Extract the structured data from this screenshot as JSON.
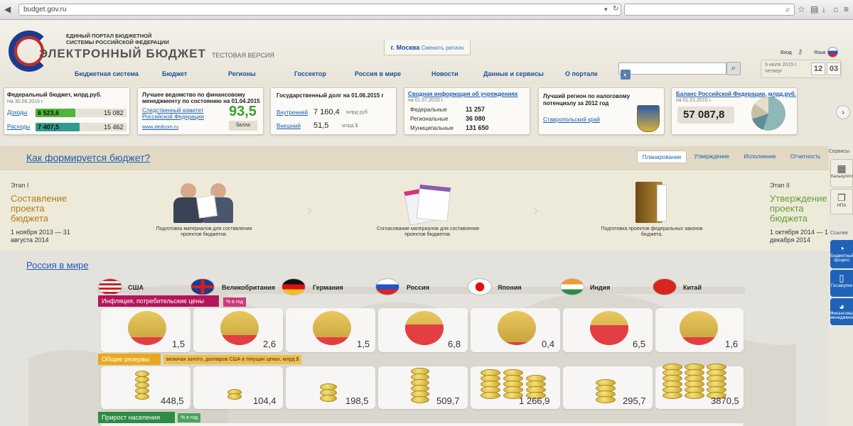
{
  "browser": {
    "url": "budget.gov.ru"
  },
  "header": {
    "logo_small": "ЕДИНЫЙ ПОРТАЛ БЮДЖЕТНОЙ СИСТЕМЫ РОССИЙСКОЙ ФЕДЕРАЦИИ",
    "logo_big": "ЭЛЕКТРОННЫЙ БЮДЖЕТ",
    "test_version": "ТЕСТОВАЯ ВЕРСИЯ",
    "city": "г. Москва",
    "change_region": "Сменить регион",
    "login": "Вход",
    "lang": "Язык",
    "date_line1": "9 июля 2015 г.",
    "date_line2": "четверг",
    "clock_h": "12",
    "clock_m": "03"
  },
  "nav": [
    "Бюджетная система",
    "Бюджет",
    "Регионы",
    "Госсектор",
    "Россия в мире",
    "Новости",
    "Данные и сервисы",
    "О портале"
  ],
  "cards": {
    "federal": {
      "title": "Федеральный бюджет, млрд.руб.",
      "date": "На 30.06.2015 г.",
      "income_label": "Доходы",
      "income_val": "6 523,6",
      "income_plan": "15 082",
      "expense_label": "Расходы",
      "expense_val": "7 407,5",
      "expense_plan": "15 462"
    },
    "agency": {
      "title": "Лучшее ведомство по финансовому менеджменту по состоянию на 01.04.2015",
      "name": "Следственный комитет Российской Федерации",
      "site": "www.sledcom.ru",
      "score": "93,5",
      "score_unit": "балла"
    },
    "debt": {
      "title": "Государственный долг на 01.06.2015 г",
      "internal_label": "Внутренний",
      "internal_val": "7 160,4",
      "internal_unit": "млрд руб.",
      "external_label": "Внешний",
      "external_val": "51,5",
      "external_unit": "млрд $"
    },
    "inst": {
      "title": "Сводная информация об учреждениях",
      "date": "на 01.07.2015 г.",
      "rows": [
        {
          "label": "Федеральные",
          "val": "11 257"
        },
        {
          "label": "Региональные",
          "val": "36 080"
        },
        {
          "label": "Муниципальные",
          "val": "131 650"
        }
      ]
    },
    "region": {
      "title": "Лучший регион по налоговому потенциалу за 2012 год",
      "name": "Ставропольский край"
    },
    "balance": {
      "title": "Баланс Российской Федерации, млрд.руб.",
      "date": "на 01.01.2015 г.",
      "val": "57 087,8"
    }
  },
  "budget": {
    "title": "Как формируется бюджет?",
    "tabs": [
      "Планирование",
      "Утверждение",
      "Исполнение",
      "Отчетность"
    ],
    "stage1": {
      "label": "Этап I",
      "heading": "Составление проекта бюджета",
      "dates": "1 ноября 2013 — 31 августа 2014"
    },
    "stage2": {
      "label": "Этап II",
      "heading": "Утверждение проекта бюджета",
      "dates": "1 октября 2014 — 1 декабря 2014"
    },
    "captions": [
      "Подготовка материалов для составления проектов бюджетов.",
      "Согласование материалов для составления проектов бюджетов.",
      "Подготовка проектов федеральных законов бюджета."
    ]
  },
  "sidebar": {
    "services": "Сервисы",
    "calc": "Калькуляторы",
    "npa": "НПА",
    "links": "Ссылки",
    "bp": "Бюджетный процесс",
    "goszakupki": "Госзакупки",
    "finman": "Финансовый менеджмент"
  },
  "world": {
    "title": "Россия в мире",
    "countries": [
      "США",
      "Великобритания",
      "Германия",
      "Россия",
      "Япония",
      "Индия",
      "Китай"
    ],
    "inflation": {
      "label": "Инфляция, потребительские цены",
      "unit": "% в год",
      "values": [
        "1,5",
        "2,6",
        "1,5",
        "6,8",
        "0,4",
        "6,5",
        "1,6"
      ]
    },
    "reserves": {
      "label": "Общие резервы",
      "unit": "включая золото, долларов США в текущих ценах, млрд $",
      "values": [
        "448,5",
        "104,4",
        "198,5",
        "509,7",
        "1 266,9",
        "295,7",
        "3870,5"
      ]
    },
    "population": {
      "label": "Прирост населения",
      "unit": "% в год"
    }
  },
  "colors": {
    "accent": "#1b5fb0",
    "income": "#52b43a",
    "expense": "#2f9b8c",
    "inflation": "#b5165a",
    "reserves": "#e8a91c",
    "population": "#2e8b45"
  }
}
